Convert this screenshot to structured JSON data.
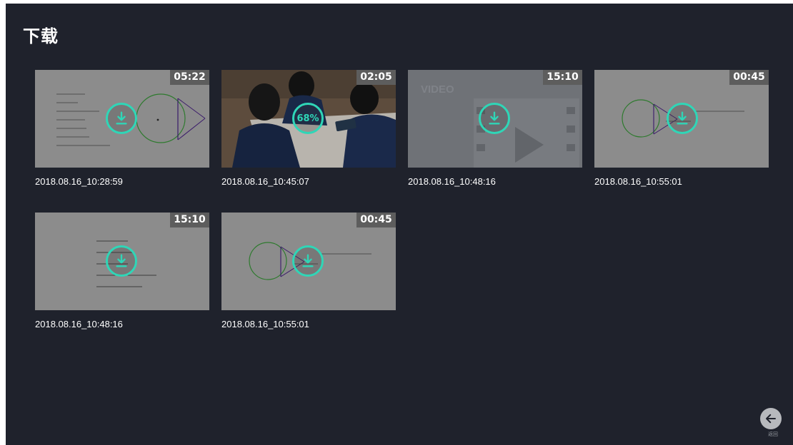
{
  "page": {
    "title": "下载"
  },
  "videos": [
    {
      "duration": "05:22",
      "caption": "2018.08.16_10:28:59",
      "status": "not-downloaded",
      "icon": "download-icon"
    },
    {
      "duration": "02:05",
      "caption": "2018.08.16_10:45:07",
      "status": "downloading",
      "progress_text": "68%",
      "progress": 0.68
    },
    {
      "duration": "15:10",
      "caption": "2018.08.16_10:48:16",
      "status": "not-downloaded",
      "icon": "download-icon",
      "watermark": "VIDEO"
    },
    {
      "duration": "00:45",
      "caption": "2018.08.16_10:55:01",
      "status": "not-downloaded",
      "icon": "download-icon"
    },
    {
      "duration": "15:10",
      "caption": "2018.08.16_10:48:16",
      "status": "not-downloaded",
      "icon": "download-icon"
    },
    {
      "duration": "00:45",
      "caption": "2018.08.16_10:55:01",
      "status": "not-downloaded",
      "icon": "download-icon"
    }
  ],
  "back": {
    "label": "返回",
    "icon": "arrow-left-icon"
  },
  "colors": {
    "background": "#1f222c",
    "accent": "#2fd6b7",
    "thumb_gray": "#8b8b8b"
  }
}
